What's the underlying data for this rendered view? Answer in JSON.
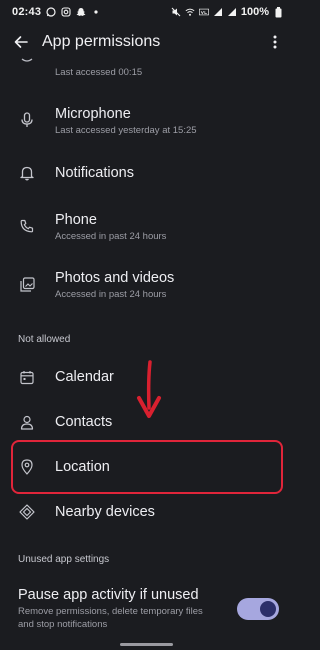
{
  "status_bar": {
    "time": "02:43",
    "battery": "100%",
    "left_icons": [
      "whatsapp-icon",
      "instagram-icon",
      "snapchat-icon",
      "dot-icon"
    ],
    "right_icons": [
      "mute-icon",
      "wifi-icon",
      "volte-icon",
      "signal-icon",
      "signal2-icon"
    ]
  },
  "app_bar": {
    "title": "App permissions",
    "back_icon": "arrow-left-icon",
    "menu_icon": "more-vert-icon"
  },
  "allowed": [
    {
      "title": "",
      "subtitle": "Last accessed 00:15",
      "icon": "partial-icon"
    },
    {
      "title": "Microphone",
      "subtitle": "Last accessed yesterday at 15:25",
      "icon": "mic-icon"
    },
    {
      "title": "Notifications",
      "subtitle": "",
      "icon": "bell-icon"
    },
    {
      "title": "Phone",
      "subtitle": "Accessed in past 24 hours",
      "icon": "phone-icon"
    },
    {
      "title": "Photos and videos",
      "subtitle": "Accessed in past 24 hours",
      "icon": "photos-icon"
    }
  ],
  "not_allowed_header": "Not allowed",
  "not_allowed": [
    {
      "title": "Calendar",
      "icon": "calendar-icon"
    },
    {
      "title": "Contacts",
      "icon": "person-icon"
    },
    {
      "title": "Location",
      "icon": "location-pin-icon"
    },
    {
      "title": "Nearby devices",
      "icon": "nearby-icon"
    }
  ],
  "unused_header": "Unused app settings",
  "pause": {
    "title": "Pause app activity if unused",
    "subtitle_line1": "Remove permissions, delete temporary files",
    "subtitle_line2": "and stop notifications",
    "enabled": true
  },
  "colors": {
    "background": "#1b1c20",
    "highlight": "#e0253a",
    "toggle_track": "#a6a7df",
    "toggle_knob": "#2c2f6a"
  }
}
